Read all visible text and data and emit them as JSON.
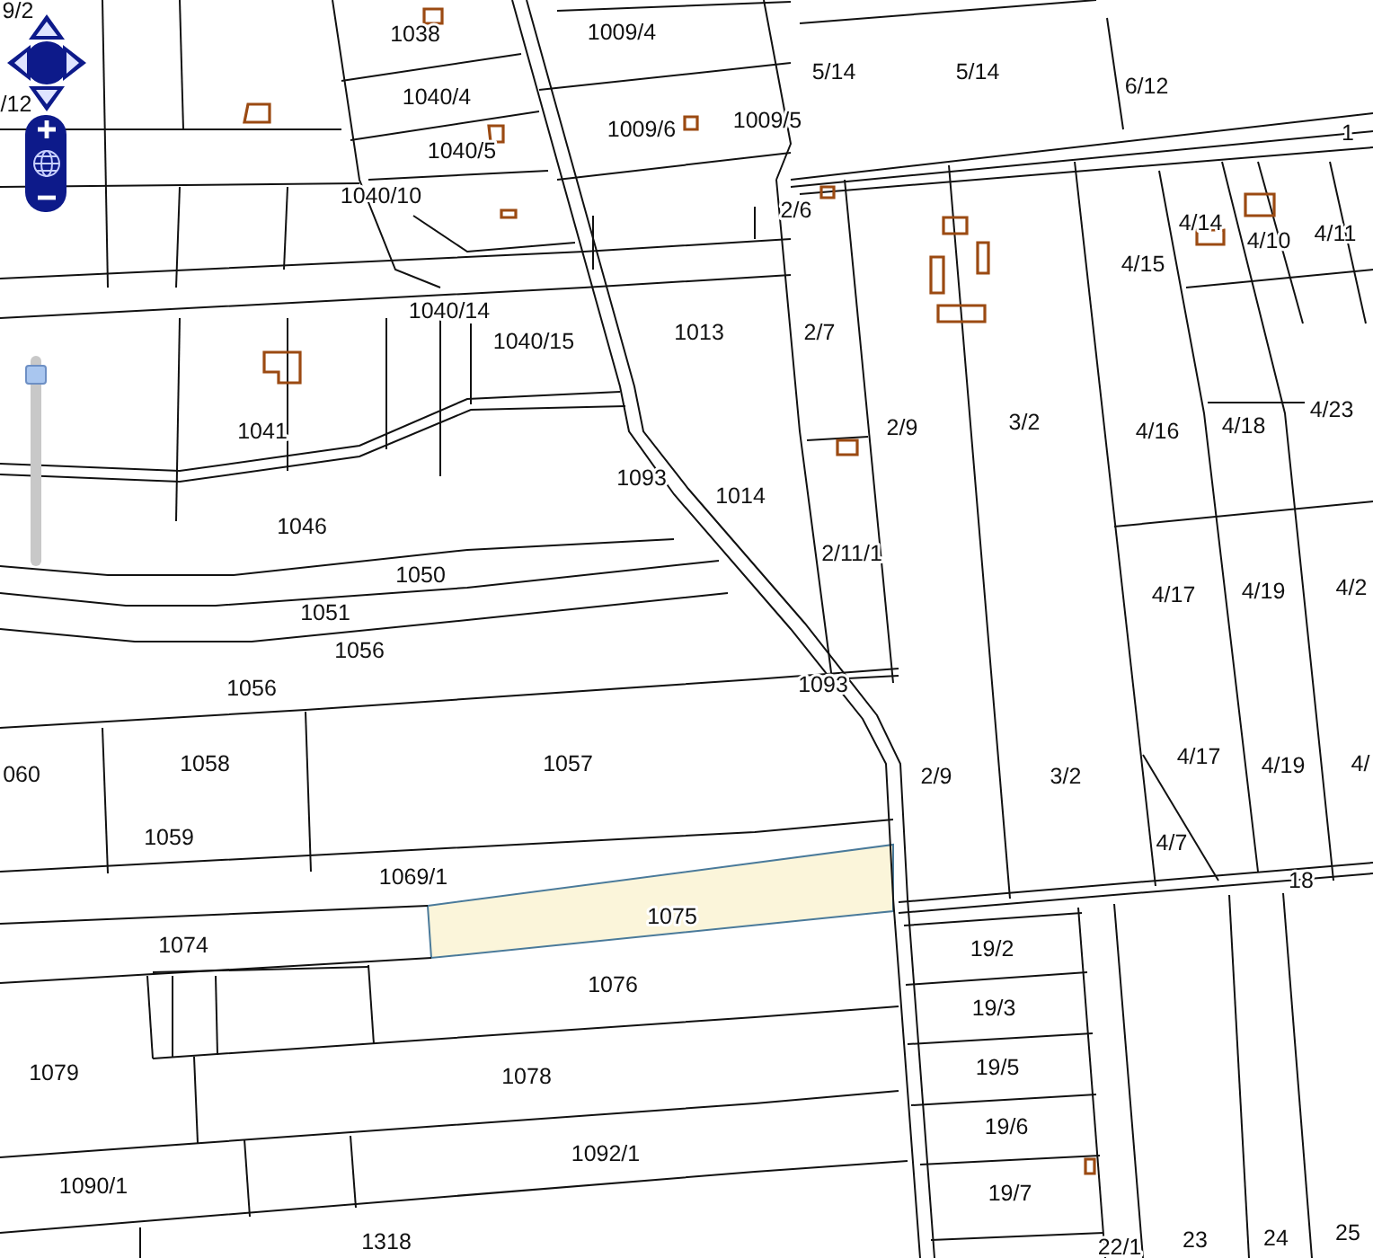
{
  "map_controls": {
    "zoom_slider": {
      "level": 0.97
    }
  },
  "parcels": [
    {
      "label": "9/2",
      "selected": false
    },
    {
      "label": "/12",
      "selected": false
    },
    {
      "label": "1038",
      "selected": false
    },
    {
      "label": "1009/4",
      "selected": false
    },
    {
      "label": "5/14",
      "selected": false
    },
    {
      "label": "5/14",
      "selected": false
    },
    {
      "label": "6/12",
      "selected": false
    },
    {
      "label": "1",
      "selected": false
    },
    {
      "label": "1040/4",
      "selected": false
    },
    {
      "label": "1009/6",
      "selected": false
    },
    {
      "label": "1009/5",
      "selected": false
    },
    {
      "label": "1040/5",
      "selected": false
    },
    {
      "label": "1040/10",
      "selected": false
    },
    {
      "label": "2/6",
      "selected": false
    },
    {
      "label": "4/14",
      "selected": false
    },
    {
      "label": "4/10",
      "selected": false
    },
    {
      "label": "4/11",
      "selected": false
    },
    {
      "label": "4/15",
      "selected": false
    },
    {
      "label": "1040/14",
      "selected": false
    },
    {
      "label": "1040/15",
      "selected": false
    },
    {
      "label": "1013",
      "selected": false
    },
    {
      "label": "2/7",
      "selected": false
    },
    {
      "label": "1041",
      "selected": false
    },
    {
      "label": "2/9",
      "selected": false
    },
    {
      "label": "3/2",
      "selected": false
    },
    {
      "label": "4/16",
      "selected": false
    },
    {
      "label": "4/18",
      "selected": false
    },
    {
      "label": "4/23",
      "selected": false
    },
    {
      "label": "1093",
      "selected": false
    },
    {
      "label": "1014",
      "selected": false
    },
    {
      "label": "1046",
      "selected": false
    },
    {
      "label": "2/11/1",
      "selected": false
    },
    {
      "label": "1050",
      "selected": false
    },
    {
      "label": "1051",
      "selected": false
    },
    {
      "label": "4/17",
      "selected": false
    },
    {
      "label": "4/19",
      "selected": false
    },
    {
      "label": "4/2",
      "selected": false
    },
    {
      "label": "1056",
      "selected": false
    },
    {
      "label": "1056",
      "selected": false
    },
    {
      "label": "1093",
      "selected": false
    },
    {
      "label": "060",
      "selected": false
    },
    {
      "label": "1058",
      "selected": false
    },
    {
      "label": "1057",
      "selected": false
    },
    {
      "label": "2/9",
      "selected": false
    },
    {
      "label": "3/2",
      "selected": false
    },
    {
      "label": "4/17",
      "selected": false
    },
    {
      "label": "4/19",
      "selected": false
    },
    {
      "label": "4/",
      "selected": false
    },
    {
      "label": "1059",
      "selected": false
    },
    {
      "label": "4/7",
      "selected": false
    },
    {
      "label": "18",
      "selected": false
    },
    {
      "label": "1069/1",
      "selected": false
    },
    {
      "label": "1075",
      "selected": true
    },
    {
      "label": "1074",
      "selected": false
    },
    {
      "label": "1076",
      "selected": false
    },
    {
      "label": "19/2",
      "selected": false
    },
    {
      "label": "19/3",
      "selected": false
    },
    {
      "label": "19/5",
      "selected": false
    },
    {
      "label": "19/6",
      "selected": false
    },
    {
      "label": "19/7",
      "selected": false
    },
    {
      "label": "1079",
      "selected": false
    },
    {
      "label": "1078",
      "selected": false
    },
    {
      "label": "1092/1",
      "selected": false
    },
    {
      "label": "1090/1",
      "selected": false
    },
    {
      "label": "1318",
      "selected": false
    },
    {
      "label": "22/1",
      "selected": false
    },
    {
      "label": "23",
      "selected": false
    },
    {
      "label": "24",
      "selected": false
    },
    {
      "label": "25",
      "selected": false
    }
  ]
}
